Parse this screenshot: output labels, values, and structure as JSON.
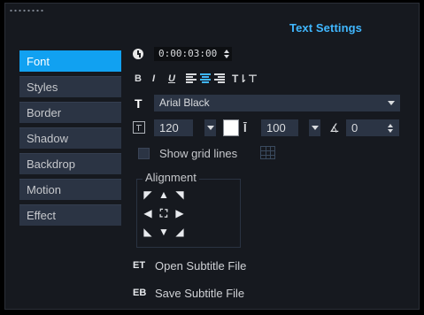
{
  "header": {
    "title": "Text Settings"
  },
  "tabs": [
    {
      "label": "Font",
      "active": true
    },
    {
      "label": "Styles"
    },
    {
      "label": "Border"
    },
    {
      "label": "Shadow"
    },
    {
      "label": "Backdrop"
    },
    {
      "label": "Motion"
    },
    {
      "label": "Effect"
    }
  ],
  "time": {
    "value": "0:00:03:00"
  },
  "formatting": {
    "bold": "B",
    "italic": "I",
    "underline": "U"
  },
  "font": {
    "selected": "Arial Black"
  },
  "size": {
    "value": "120"
  },
  "line_spacing": {
    "value": "100"
  },
  "angle": {
    "value": "0"
  },
  "grid": {
    "label": "Show grid lines"
  },
  "alignment": {
    "label": "Alignment"
  },
  "actions": {
    "open": "Open Subtitle File",
    "save": "Save Subtitle File"
  },
  "colors": {
    "accent": "#11a1f1",
    "title": "#40b7ff",
    "text_color_swatch": "#ffffff"
  }
}
